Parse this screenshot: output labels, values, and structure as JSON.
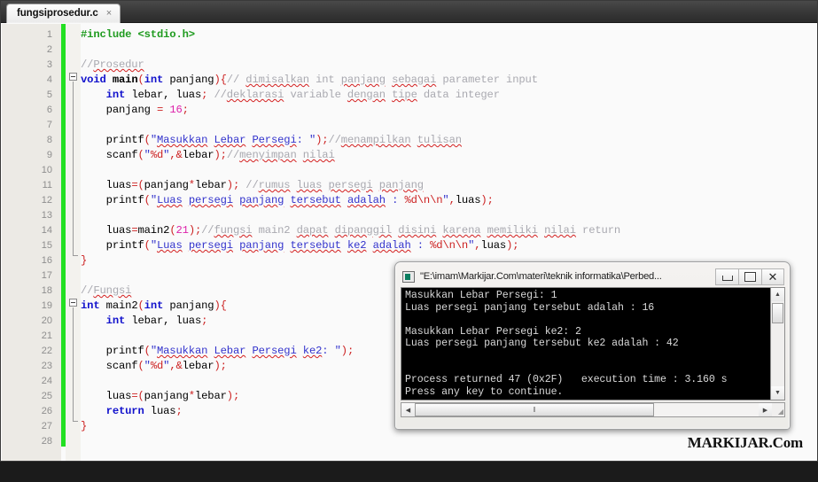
{
  "tab": {
    "label": "fungsiprosedur.c",
    "close_icon": "×"
  },
  "editor": {
    "line_numbers": [
      1,
      2,
      3,
      4,
      5,
      6,
      7,
      8,
      9,
      10,
      11,
      12,
      13,
      14,
      15,
      16,
      17,
      18,
      19,
      20,
      21,
      22,
      23,
      24,
      25,
      26,
      27,
      28
    ],
    "lines": [
      {
        "n": 1,
        "text": "#include <stdio.h>"
      },
      {
        "n": 2,
        "text": ""
      },
      {
        "n": 3,
        "text": "//Prosedur"
      },
      {
        "n": 4,
        "text": "void main(int panjang){// dimisalkan int panjang sebagai parameter input"
      },
      {
        "n": 5,
        "text": "    int lebar, luas; //deklarasi variable dengan tipe data integer"
      },
      {
        "n": 6,
        "text": "    panjang = 16;"
      },
      {
        "n": 7,
        "text": ""
      },
      {
        "n": 8,
        "text": "    printf(\"Masukkan Lebar Persegi: \");//menampilkan tulisan"
      },
      {
        "n": 9,
        "text": "    scanf(\"%d\",&lebar);//menyimpan nilai"
      },
      {
        "n": 10,
        "text": ""
      },
      {
        "n": 11,
        "text": "    luas=(panjang*lebar); //rumus luas persegi panjang"
      },
      {
        "n": 12,
        "text": "    printf(\"Luas persegi panjang tersebut adalah : %d\\n\\n\",luas);"
      },
      {
        "n": 13,
        "text": ""
      },
      {
        "n": 14,
        "text": "    luas=main2(21);//fungsi main2 dapat dipanggil disini karena memiliki nilai return"
      },
      {
        "n": 15,
        "text": "    printf(\"Luas persegi panjang tersebut ke2 adalah : %d\\n\\n\",luas);"
      },
      {
        "n": 16,
        "text": "}"
      },
      {
        "n": 17,
        "text": ""
      },
      {
        "n": 18,
        "text": "//Fungsi"
      },
      {
        "n": 19,
        "text": "int main2(int panjang){"
      },
      {
        "n": 20,
        "text": "    int lebar, luas;"
      },
      {
        "n": 21,
        "text": ""
      },
      {
        "n": 22,
        "text": "    printf(\"Masukkan Lebar Persegi ke2: \");"
      },
      {
        "n": 23,
        "text": "    scanf(\"%d\",&lebar);"
      },
      {
        "n": 24,
        "text": ""
      },
      {
        "n": 25,
        "text": "    luas=(panjang*lebar);"
      },
      {
        "n": 26,
        "text": "    return luas;"
      },
      {
        "n": 27,
        "text": "}"
      },
      {
        "n": 28,
        "text": ""
      }
    ],
    "comments": {
      "c3": "//Prosedur",
      "c4": "// dimisalkan int panjang sebagai parameter input",
      "c5": "//deklarasi variable dengan tipe data integer",
      "c8": "//menampilkan tulisan",
      "c9": "//menyimpan nilai",
      "c11": "//rumus luas persegi panjang",
      "c14": "//fungsi main2 dapat dipanggil disini karena memiliki nilai return",
      "c18": "//Fungsi"
    },
    "colors": {
      "preprocessor": "#1f9b1f",
      "keyword": "#1111cc",
      "string": "#3333cc",
      "punctuation": "#cc2222",
      "number": "#dd22aa",
      "comment": "#a9a9b0",
      "spellcheck_underline": "#d42020",
      "bookmark_bar": "#22e022",
      "background": "#fafafa",
      "gutter": "#eceae5"
    }
  },
  "console": {
    "title": "\"E:\\imam\\Markijar.Com\\materi\\teknik informatika\\Perbed...",
    "icon": "console-app-icon",
    "buttons": {
      "minimize": "minimize-button",
      "maximize": "restore-button",
      "close": "✕"
    },
    "output": "Masukkan Lebar Persegi: 1\nLuas persegi panjang tersebut adalah : 16\n\nMasukkan Lebar Persegi ke2: 2\nLuas persegi panjang tersebut ke2 adalah : 42\n\n\nProcess returned 47 (0x2F)   execution time : 3.160 s\nPress any key to continue.",
    "scroll": {
      "up_arrow": "▲",
      "down_arrow": "▼",
      "left_arrow": "◀",
      "right_arrow": "▶",
      "grip": "‖"
    }
  },
  "watermark": {
    "text": "MARKIJAR.Com"
  }
}
